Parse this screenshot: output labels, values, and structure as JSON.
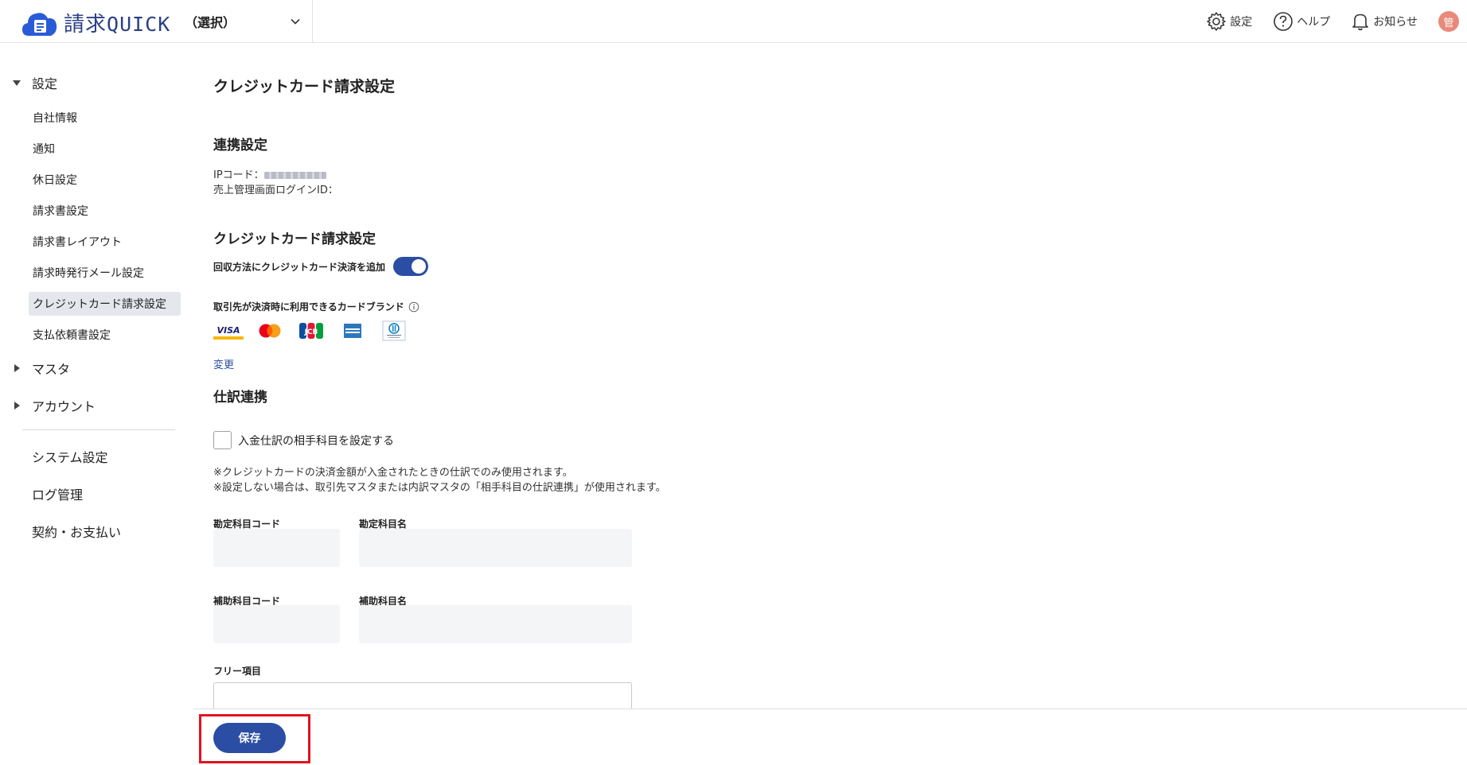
{
  "header": {
    "logo_text": "請求",
    "logo_accent": "QUICK",
    "company_selector": "（選択）",
    "settings_label": "設定",
    "help_label": "ヘルプ",
    "notice_label": "お知らせ",
    "avatar_initial": "管"
  },
  "sidebar": {
    "group_settings": "設定",
    "items": [
      {
        "label": "自社情報"
      },
      {
        "label": "通知"
      },
      {
        "label": "休日設定"
      },
      {
        "label": "請求書設定"
      },
      {
        "label": "請求書レイアウト"
      },
      {
        "label": "請求時発行メール設定"
      },
      {
        "label": "クレジットカード請求設定"
      },
      {
        "label": "支払依頼書設定"
      }
    ],
    "group_master": "マスタ",
    "group_account": "アカウント",
    "system_settings": "システム設定",
    "log_management": "ログ管理",
    "contract_payment": "契約・お支払い"
  },
  "main": {
    "page_title": "クレジットカード請求設定",
    "integration": {
      "title": "連携設定",
      "ip_code_label": "IPコード：",
      "sales_login_label": "売上管理画面ログインID："
    },
    "credit": {
      "title": "クレジットカード請求設定",
      "toggle_label": "回収方法にクレジットカード決済を追加",
      "toggle_on": true,
      "brands_label": "取引先が決済時に利用できるカードブランド",
      "brands": [
        "VISA",
        "Mastercard",
        "JCB",
        "American Express",
        "Diners Club"
      ],
      "visa_text": "VISA",
      "jcb_text": "JCB",
      "change_link": "変更"
    },
    "journal": {
      "title": "仕訳連携",
      "checkbox_label": "入金仕訳の相手科目を設定する",
      "note1": "※クレジットカードの決済金額が入金されたときの仕訳でのみ使用されます。",
      "note2": "※設定しない場合は、取引先マスタまたは内訳マスタの「相手科目の仕訳連携」が使用されます。",
      "account_code_label": "勘定科目コード",
      "account_name_label": "勘定科目名",
      "sub_code_label": "補助科目コード",
      "sub_name_label": "補助科目名",
      "free_label": "フリー項目"
    }
  },
  "footer": {
    "save_label": "保存"
  },
  "colors": {
    "primary": "#2b4da3",
    "highlight": "#e0141e",
    "avatar": "#e9897a"
  }
}
